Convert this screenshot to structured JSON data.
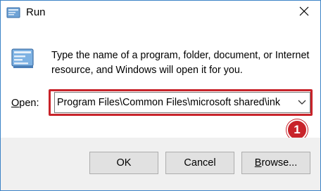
{
  "window": {
    "title": "Run",
    "icon": "run-icon",
    "close_icon": "close-icon"
  },
  "dialog": {
    "description": "Type the name of a program, folder, document, or Internet resource, and Windows will open it for you.",
    "open_label_prefix": "O",
    "open_label_rest": "pen:",
    "open_value": "Program Files\\Common Files\\microsoft shared\\ink",
    "dropdown_icon": "chevron-down-icon"
  },
  "annotation": {
    "badge_number": "1",
    "highlight_color": "#c8232a"
  },
  "buttons": {
    "ok_label": "OK",
    "cancel_label": "Cancel",
    "browse_prefix": "B",
    "browse_rest": "rowse..."
  },
  "colors": {
    "window_border": "#3c83c7",
    "footer_bg": "#f0f0f0",
    "button_bg": "#e1e1e1"
  }
}
